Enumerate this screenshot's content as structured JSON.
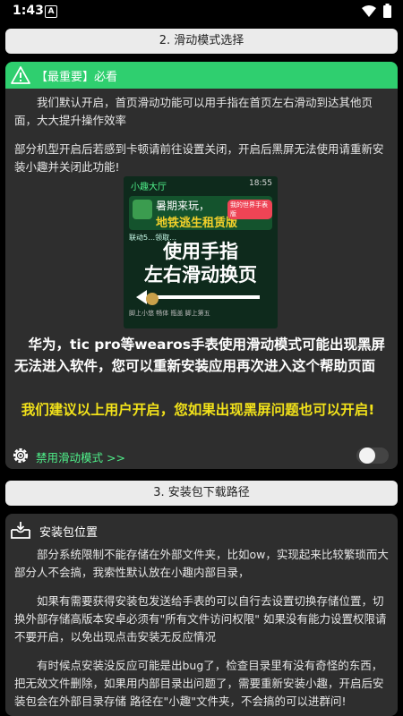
{
  "status_bar": {
    "time": "1:43",
    "app_icon": "A"
  },
  "section2": {
    "header": "2. 滑动模式选择",
    "warning_label": "【最重要】必看",
    "para1": "我们默认开启，首页滑动功能可以用手指在首页左右滑动到达其他页面，大大提升操作效率",
    "para2": "部分机型开启后若感到卡顿请前往设置关闭，开启后黑屏无法使用请重新安装小趣并关闭此功能!",
    "screenshot": {
      "app_title": "小趣大厅",
      "time": "18:55",
      "banner_line1": "暑期来玩，",
      "banner_line2": "地铁逃生租赁版",
      "banner_badge": "我的世界手表版",
      "row_text": "联动5…领取…",
      "overlay_line1": "使用手指",
      "overlay_line2": "左右滑动换页",
      "nav_text": "滑动前中 … 乐号中心",
      "apps_row": "脚上小悠 畅体 瓶盖 脚上第五",
      "bottom_text": "…"
    },
    "para3": "华为，tic pro等wearos手表使用滑动模式可能出现黑屏无法进入软件，您可以重新安装应用再次进入这个帮助页面",
    "para4": "我们建议以上用户开启，您如果出现黑屏问题也可以开启!",
    "toggle_label": "禁用滑动模式 >>",
    "toggle_on": false
  },
  "section3": {
    "header": "3. 安装包下载路径",
    "title": "安装包位置",
    "para1": "部分系统限制不能存储在外部文件夹，比如ow，实现起来比较繁琐而大部分人不会搞，我索性默认放在小趣内部目录，",
    "para2": "如果有需要获得安装包发送给手表的可以自行去设置切换存储位置，切换外部存储高版本安卓必须有\"所有文件访问权限\" 如果没有能力设置权限请不要开启，以免出现点击安装无反应情况",
    "para3": "有时候点安装没反应可能是出bug了，检查目录里有没有奇怪的东西，把无效文件删除，如果用内部目录出问题了，需要重新安装小趣，开启后安装包会在外部目录存储 路径在\"小趣\"文件夹，不会搞的可以进群问!"
  },
  "colors": {
    "accent_green": "#2fcf6f",
    "highlight_yellow": "#f2e21a",
    "link_green": "#4ff08a",
    "card_bg": "#2e2e2e",
    "header_bg": "#ebebeb"
  }
}
